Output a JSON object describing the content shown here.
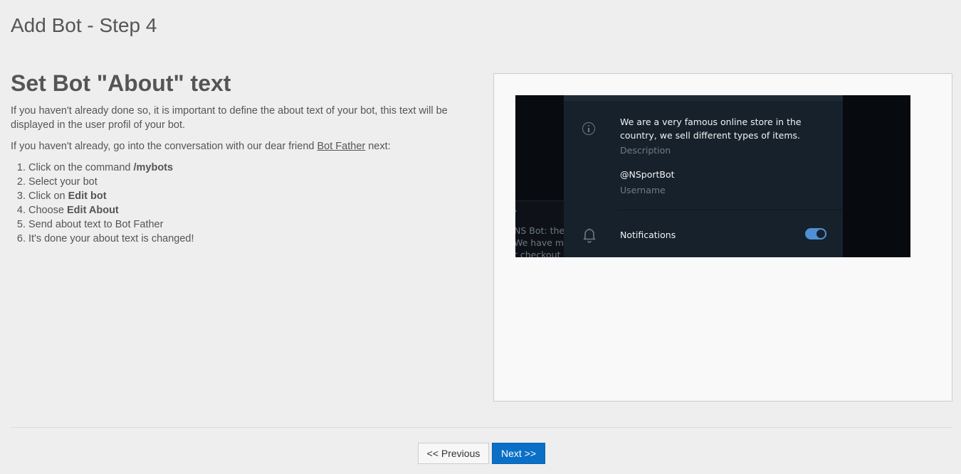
{
  "page": {
    "title": "Add Bot - Step 4"
  },
  "section": {
    "title": "Set Bot \"About\" text",
    "intro": "If you haven't already done so, it is important to define the about text of your bot, this text will be displayed in the user profil of your bot.",
    "instruction_prefix": "If you haven't already, go into the conversation with our dear friend ",
    "instruction_link": "Bot Father",
    "instruction_suffix": " next:",
    "steps": [
      {
        "text": "Click on the command ",
        "bold": "/mybots"
      },
      {
        "text": "Select your bot",
        "bold": ""
      },
      {
        "text": "Click on ",
        "bold": "Edit bot"
      },
      {
        "text": "Choose ",
        "bold": "Edit About"
      },
      {
        "text": "Send about text to Bot Father",
        "bold": ""
      },
      {
        "text": "It's done your about text is changed!",
        "bold": ""
      }
    ]
  },
  "preview": {
    "left_snippets": [
      "NS Bot: the b",
      "We have ma",
      "t checkout"
    ],
    "description_text": "We are a very famous online store in the country, we sell different types of items.",
    "description_label": "Description",
    "username": "@NSportBot",
    "username_label": "Username",
    "notifications_label": "Notifications",
    "notifications_on": true,
    "icons": [
      "info-icon",
      "bell-icon",
      "toggle-switch"
    ],
    "colors": {
      "panel_bg": "#17212b",
      "toggle": "#4f8fd3"
    }
  },
  "nav": {
    "previous_label": "<< Previous",
    "next_label": "Next >>"
  }
}
